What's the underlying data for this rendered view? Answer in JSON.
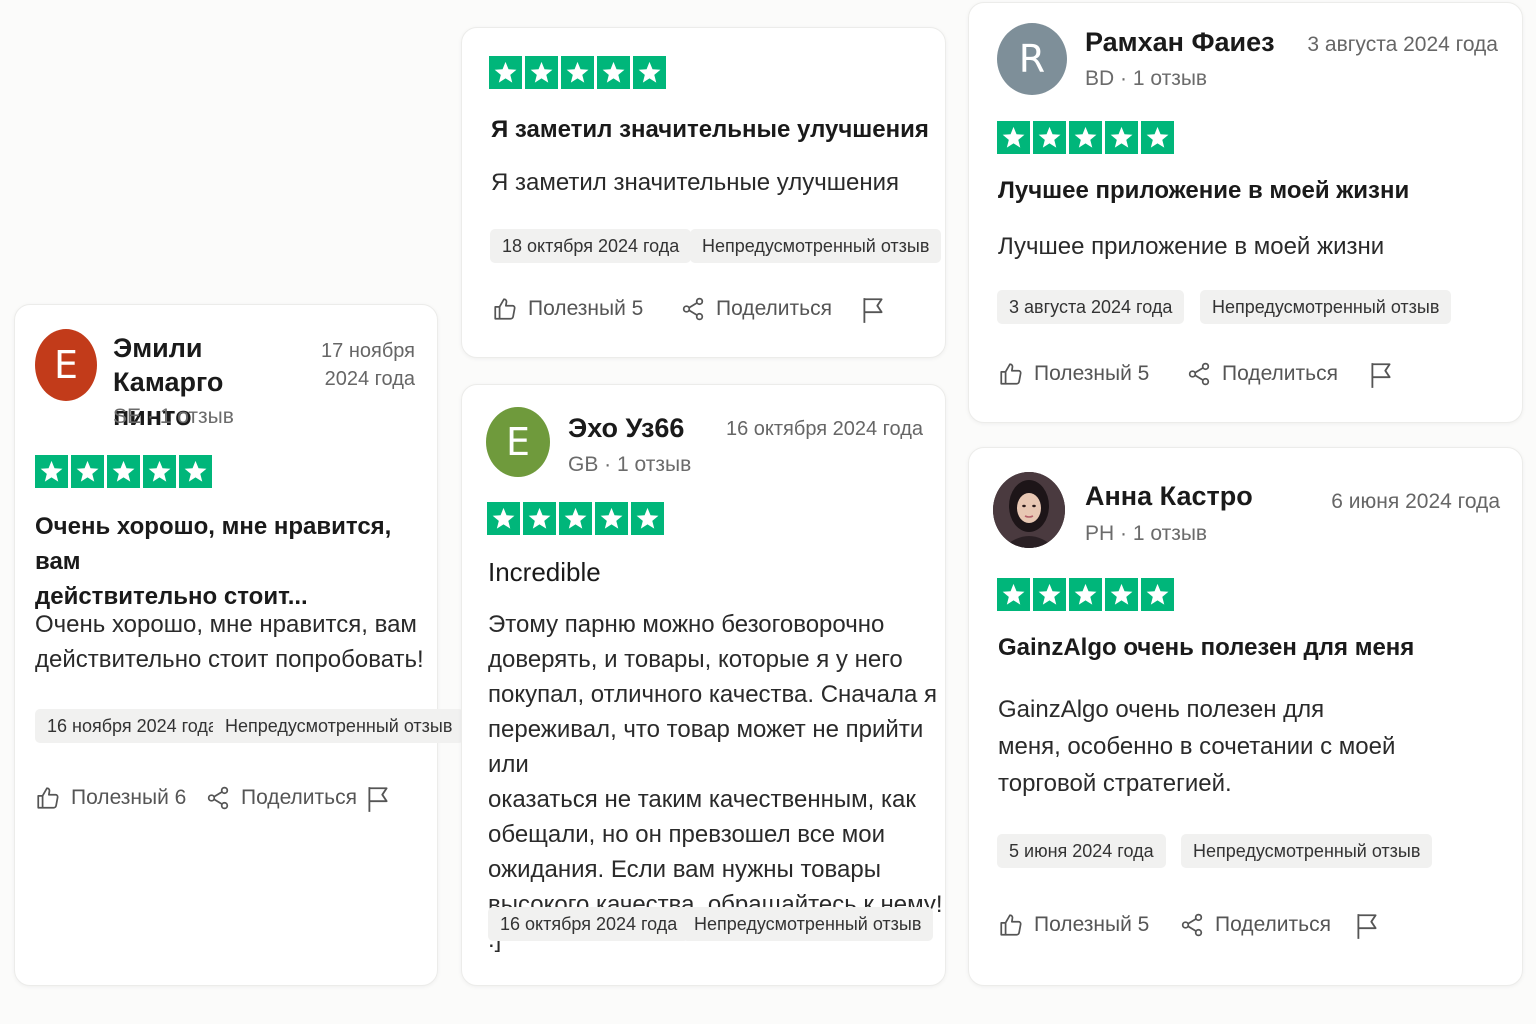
{
  "colors": {
    "star_green": "#00b67a"
  },
  "reviews": [
    {
      "name": "Эмили Камарго",
      "name_line2": "пинто",
      "avatar_letter": "E",
      "avatar_color": "#c23b1a",
      "country": "SE",
      "reviews_count": "1 отзыв",
      "date_line1": "17 ноября",
      "date_line2": "2024 года",
      "rating": 5,
      "title_line1": "Очень хорошо, мне нравится, вам",
      "title_line2": "действительно стоит...",
      "body_line1": "Очень хорошо, мне нравится, вам",
      "body_line2": "действительно стоит попробовать!",
      "experience_date": "16 ноября 2024 года",
      "tag": "Непредусмотренный отзыв",
      "useful": "Полезный 6",
      "share": "Поделиться"
    },
    {
      "rating": 5,
      "title": "Я заметил значительные улучшения",
      "body": "Я заметил значительные улучшения",
      "experience_date": "18 октября 2024 года",
      "tag": "Непредусмотренный отзыв",
      "useful": "Полезный 5",
      "share": "Поделиться"
    },
    {
      "name": "Эхо Уз66",
      "avatar_letter": "E",
      "avatar_color": "#6f9a3c",
      "country": "GB",
      "reviews_count": "1 отзыв",
      "date": "16 октября 2024 года",
      "rating": 5,
      "title": "Incredible",
      "body_lines": [
        "Этому парню можно безоговорочно",
        "доверять, и товары, которые я у него",
        "покупал, отличного качества. Сначала я",
        "переживал, что товар может не прийти или",
        "оказаться не таким качественным, как",
        "обещали, но он превзошел все мои",
        "ожидания. Если вам нужны товары",
        "высокого качества, обращайтесь к нему! :]"
      ],
      "experience_date": "16 октября 2024 года",
      "tag": "Непредусмотренный отзыв"
    },
    {
      "name": "Рамхан Фаиез",
      "avatar_letter": "R",
      "avatar_color": "#7e8f99",
      "country": "BD",
      "reviews_count": "1 отзыв",
      "date": "3 августа 2024 года",
      "rating": 5,
      "title": "Лучшее приложение в моей жизни",
      "body": "Лучшее приложение в моей жизни",
      "experience_date": "3 августа 2024 года",
      "tag": "Непредусмотренный отзыв",
      "useful": "Полезный 5",
      "share": "Поделиться"
    },
    {
      "name": "Анна Кастро",
      "country": "PH",
      "reviews_count": "1 отзыв",
      "date": "6 июня 2024 года",
      "rating": 5,
      "title": "GainzAlgo очень полезен для меня",
      "body_lines": [
        "GainzAlgo очень полезен для",
        "меня, особенно в сочетании с моей",
        "торговой стратегией."
      ],
      "experience_date": "5 июня 2024 года",
      "tag": "Непредусмотренный отзыв",
      "useful": "Полезный 5",
      "share": "Поделиться"
    }
  ]
}
